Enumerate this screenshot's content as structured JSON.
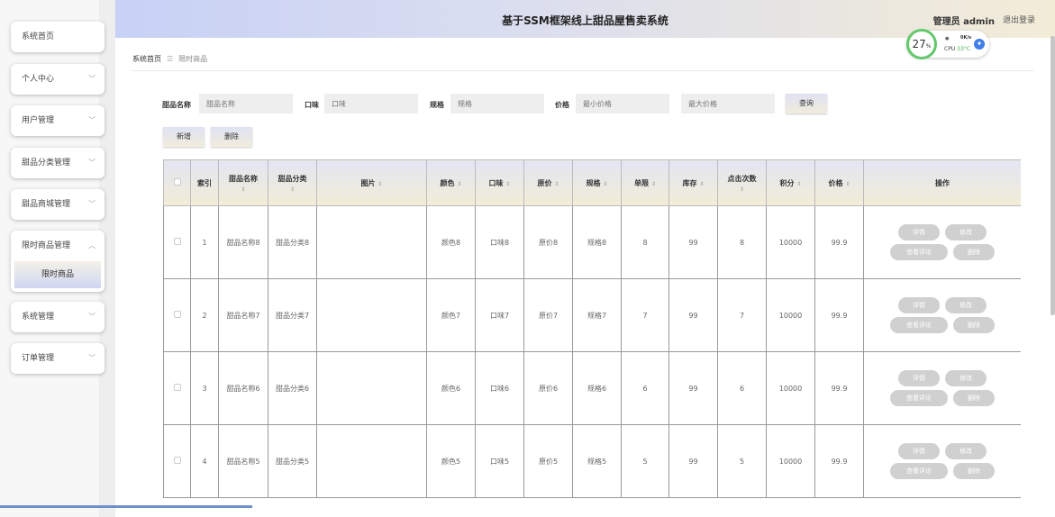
{
  "sidebar": {
    "items": [
      {
        "label": "系统首页"
      },
      {
        "label": "个人中心"
      },
      {
        "label": "用户管理"
      },
      {
        "label": "甜品分类管理"
      },
      {
        "label": "甜品商城管理"
      },
      {
        "label": "限时商品管理",
        "sub": "限时商品"
      },
      {
        "label": "系统管理"
      },
      {
        "label": "订单管理"
      }
    ]
  },
  "header": {
    "title": "基于SSM框架线上甜品屋售卖系统",
    "user": "管理员 admin",
    "logout": "退出登录"
  },
  "cpu_widget": {
    "percent": "27",
    "percent_unit": "%",
    "net": "0K/s",
    "cpu_label": "CPU",
    "temp": "33°C"
  },
  "breadcrumb": {
    "home": "系统首页",
    "current": "限时商品"
  },
  "search": {
    "name_label": "甜品名称",
    "name_placeholder": "甜品名称",
    "taste_label": "口味",
    "taste_placeholder": "口味",
    "spec_label": "规格",
    "spec_placeholder": "规格",
    "price_label": "价格",
    "min_price_placeholder": "最小价格",
    "max_price_placeholder": "最大价格",
    "query_button": "查询"
  },
  "toolbar": {
    "add_button": "新增",
    "delete_button": "删除"
  },
  "table": {
    "columns": [
      "索引",
      "甜品名称",
      "甜品分类",
      "图片",
      "颜色",
      "口味",
      "原价",
      "规格",
      "单限",
      "库存",
      "点击次数",
      "积分",
      "价格",
      "操作"
    ],
    "rows": [
      {
        "index": "1",
        "name": "甜品名称8",
        "category": "甜品分类8",
        "color": "颜色8",
        "taste": "口味8",
        "orig_price": "原价8",
        "spec": "规格8",
        "limit": "8",
        "stock": "99",
        "clicks": "8",
        "points": "10000",
        "price": "99.9"
      },
      {
        "index": "2",
        "name": "甜品名称7",
        "category": "甜品分类7",
        "color": "颜色7",
        "taste": "口味7",
        "orig_price": "原价7",
        "spec": "规格7",
        "limit": "7",
        "stock": "99",
        "clicks": "7",
        "points": "10000",
        "price": "99.9"
      },
      {
        "index": "3",
        "name": "甜品名称6",
        "category": "甜品分类6",
        "color": "颜色6",
        "taste": "口味6",
        "orig_price": "原价6",
        "spec": "规格6",
        "limit": "6",
        "stock": "99",
        "clicks": "6",
        "points": "10000",
        "price": "99.9"
      },
      {
        "index": "4",
        "name": "甜品名称5",
        "category": "甜品分类5",
        "color": "颜色5",
        "taste": "口味5",
        "orig_price": "原价5",
        "spec": "规格5",
        "limit": "5",
        "stock": "99",
        "clicks": "5",
        "points": "10000",
        "price": "99.9"
      }
    ],
    "actions": {
      "detail": "详情",
      "edit": "修改",
      "reviews": "查看评论",
      "delete": "删除"
    }
  },
  "colors": {
    "accent_green": "#63c86b",
    "header_left": "#c8d1f6",
    "header_right": "#f3ecd7",
    "action_button": "#d0d0d0"
  }
}
